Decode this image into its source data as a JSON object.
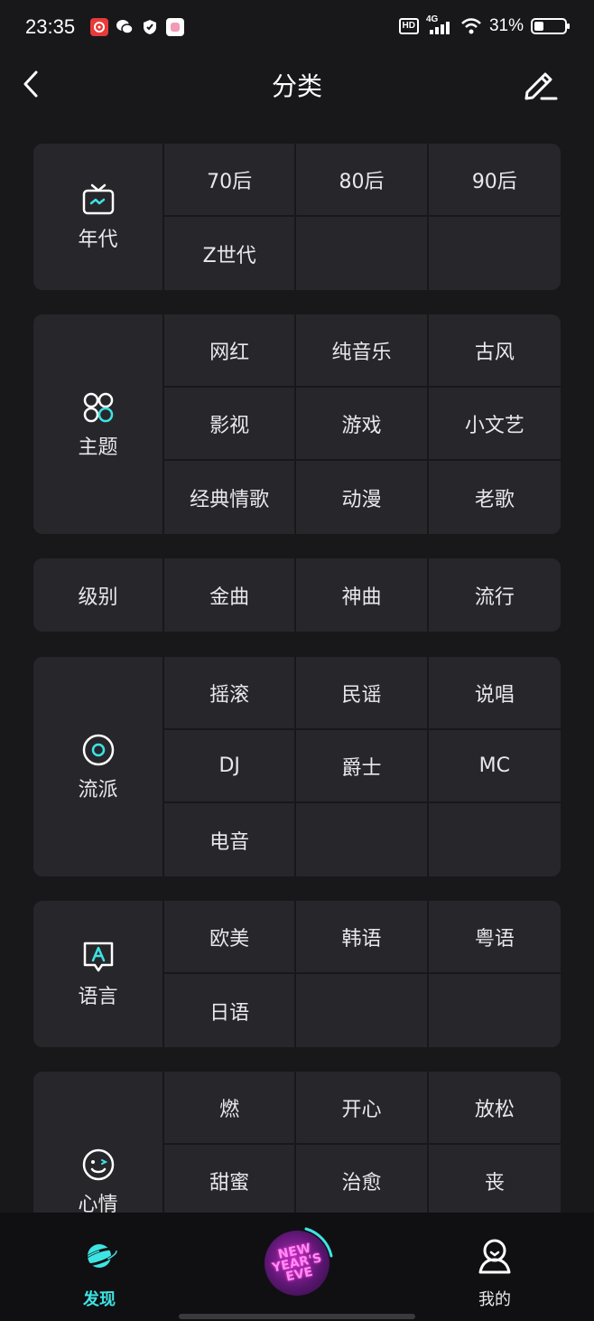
{
  "status_bar": {
    "time": "23:35",
    "hd": "HD",
    "network": "4G",
    "battery": "31%",
    "battery_level": 0.31
  },
  "header": {
    "title": "分类",
    "back_icon": "chevron-left-icon",
    "edit_icon": "edit-pencil-icon"
  },
  "sections": [
    {
      "id": "era",
      "label": "年代",
      "icon": "tv-icon",
      "items": [
        "70后",
        "80后",
        "90后",
        "Z世代",
        "",
        ""
      ]
    },
    {
      "id": "theme",
      "label": "主题",
      "icon": "grid-icon",
      "items": [
        "网红",
        "纯音乐",
        "古风",
        "影视",
        "游戏",
        "小文艺",
        "经典情歌",
        "动漫",
        "老歌"
      ]
    },
    {
      "id": "level",
      "label": "级别",
      "items": [
        "金曲",
        "神曲",
        "流行"
      ]
    },
    {
      "id": "genre",
      "label": "流派",
      "icon": "disc-icon",
      "items": [
        "摇滚",
        "民谣",
        "说唱",
        "DJ",
        "爵士",
        "MC",
        "电音",
        "",
        ""
      ]
    },
    {
      "id": "language",
      "label": "语言",
      "icon": "language-icon",
      "items": [
        "欧美",
        "韩语",
        "粤语",
        "日语",
        "",
        ""
      ]
    },
    {
      "id": "mood",
      "label": "心情",
      "icon": "smile-icon",
      "items": [
        "燃",
        "开心",
        "放松",
        "甜蜜",
        "治愈",
        "丧"
      ]
    }
  ],
  "bottom_nav": {
    "discover": "发现",
    "center": "NEW YEAR'S EVE",
    "mine": "我的"
  },
  "colors": {
    "accent": "#3ee4e4",
    "background": "#18181b",
    "card": "#27272b"
  }
}
